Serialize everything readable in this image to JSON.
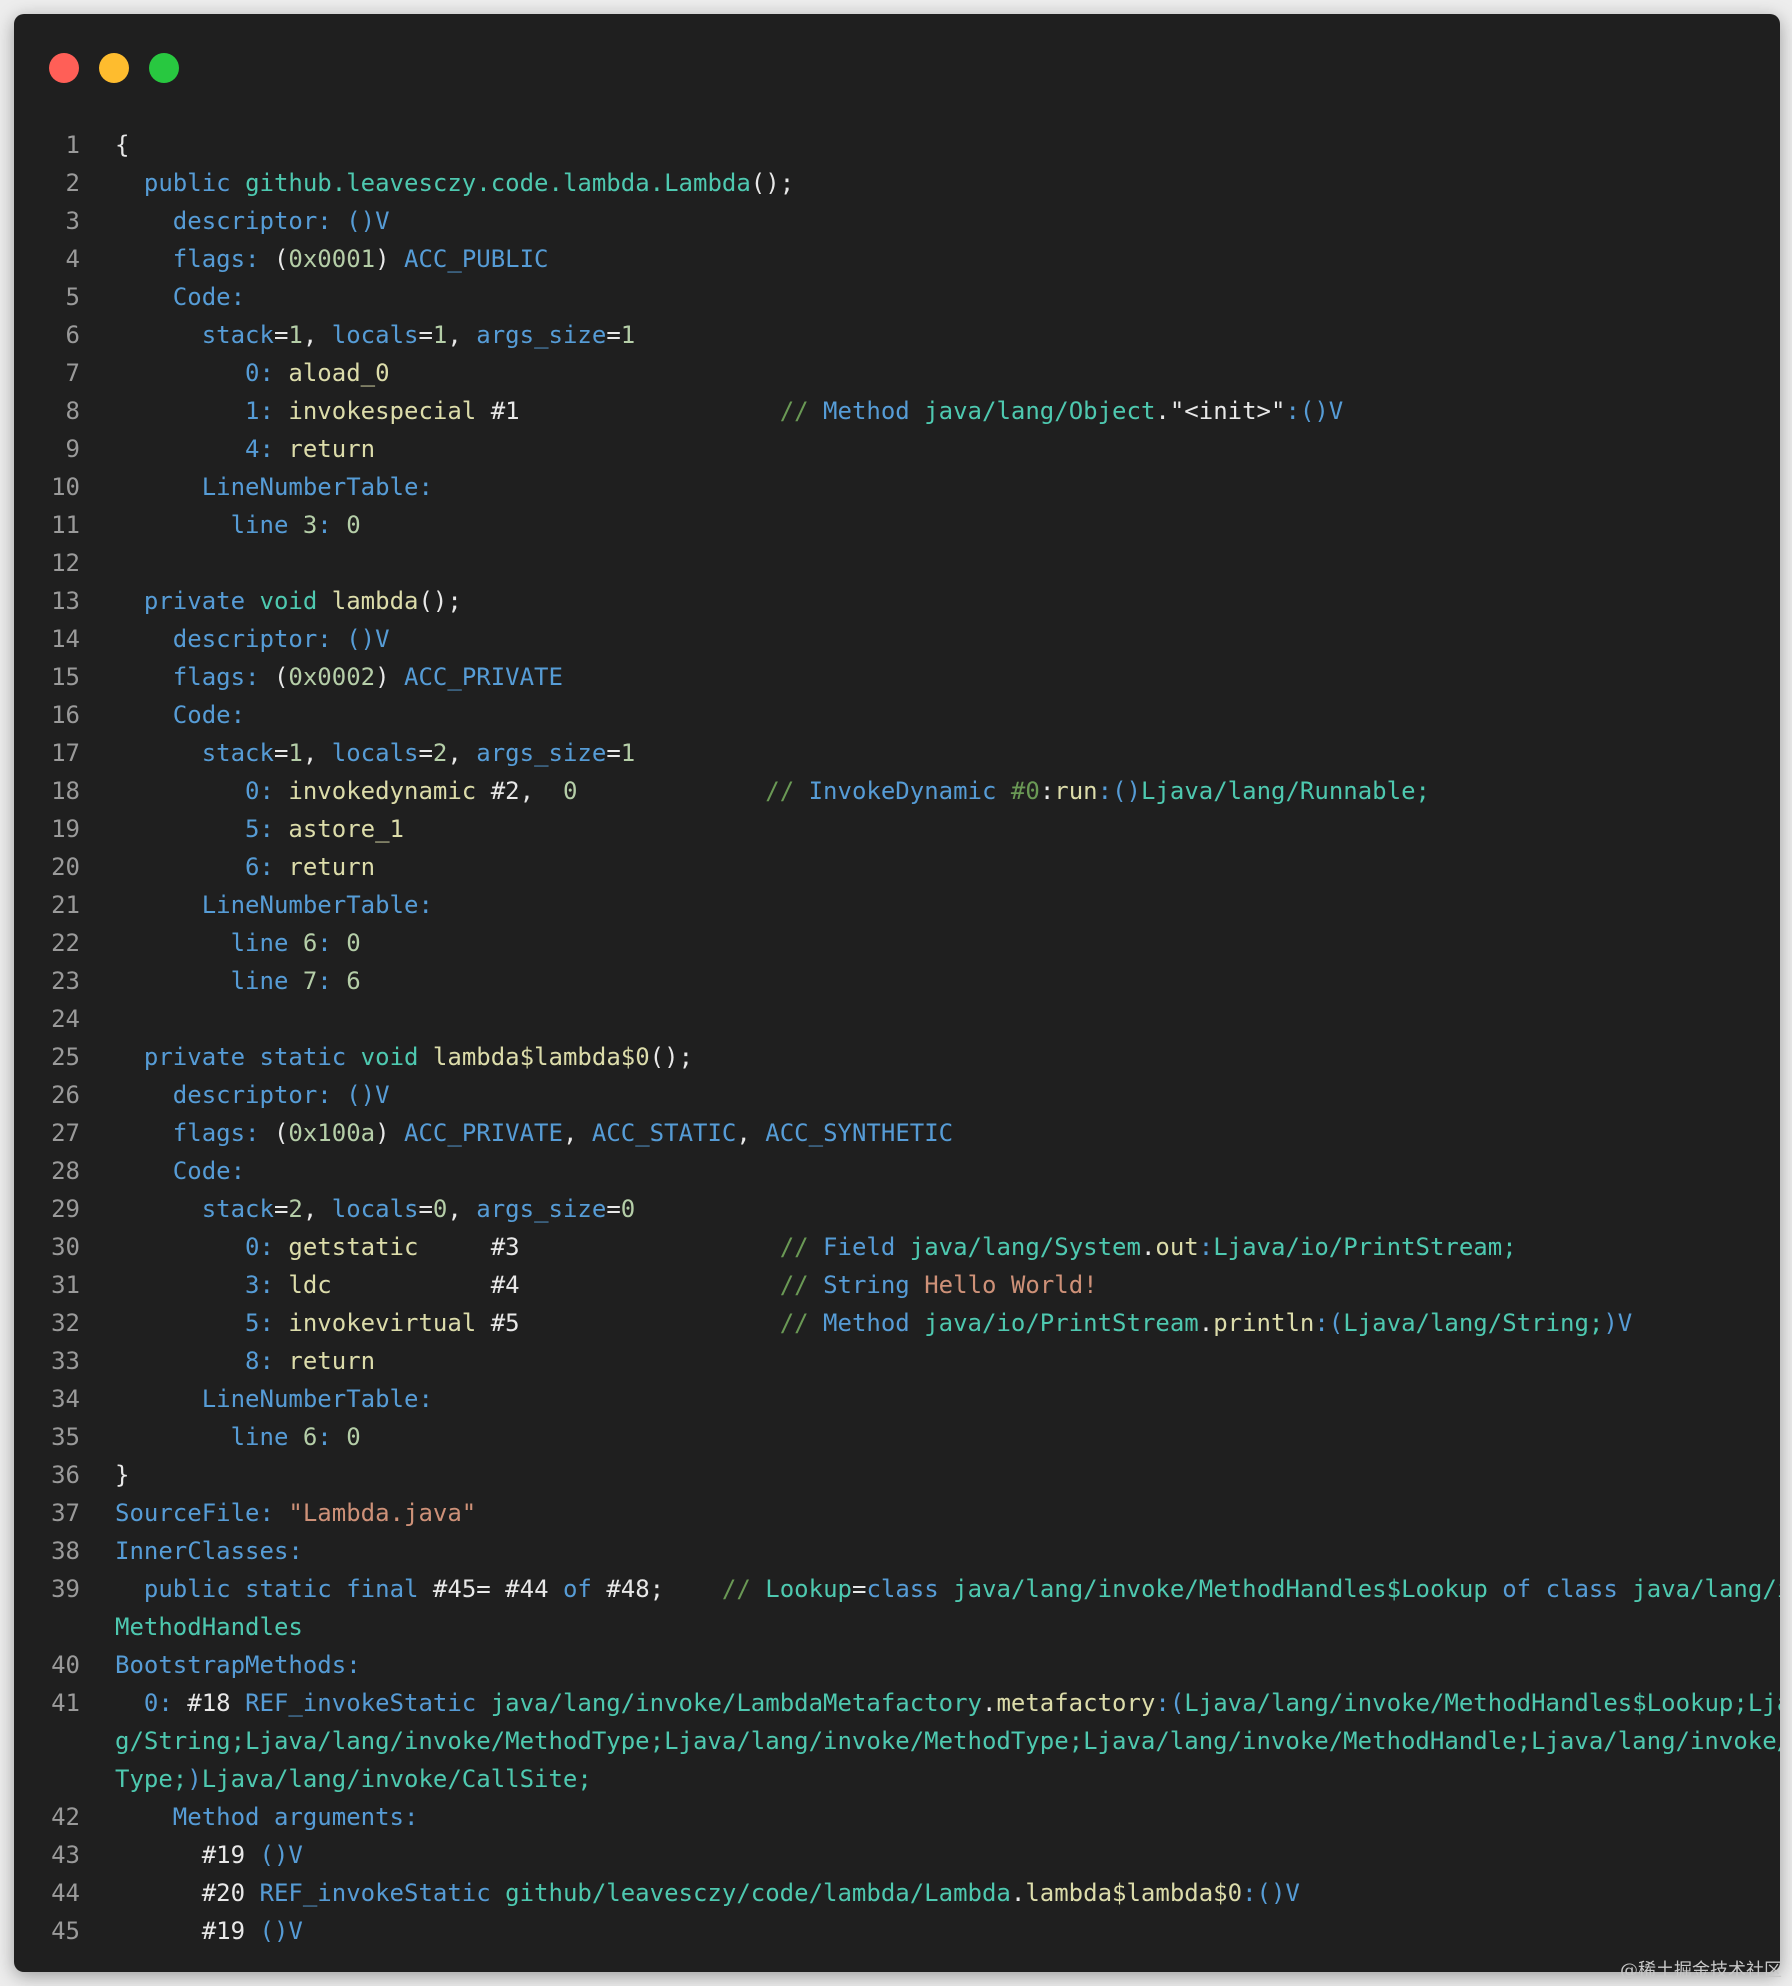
{
  "window": {
    "controls": [
      "close",
      "minimize",
      "maximize"
    ]
  },
  "lines": [
    {
      "n": "1",
      "tokens": [
        [
          "pl",
          "{"
        ]
      ]
    },
    {
      "n": "2",
      "tokens": [
        [
          "pl",
          "  "
        ],
        [
          "kw",
          "public"
        ],
        [
          "pl",
          " "
        ],
        [
          "ty",
          "github.leavesczy.code.lambda.Lambda"
        ],
        [
          "pl",
          "();"
        ]
      ]
    },
    {
      "n": "3",
      "tokens": [
        [
          "pl",
          "    "
        ],
        [
          "kw",
          "descriptor:"
        ],
        [
          "pl",
          " "
        ],
        [
          "kw",
          "()V"
        ]
      ]
    },
    {
      "n": "4",
      "tokens": [
        [
          "pl",
          "    "
        ],
        [
          "kw",
          "flags:"
        ],
        [
          "pl",
          " ("
        ],
        [
          "nm",
          "0x0001"
        ],
        [
          "pl",
          ") "
        ],
        [
          "kw",
          "ACC_PUBLIC"
        ]
      ]
    },
    {
      "n": "5",
      "tokens": [
        [
          "pl",
          "    "
        ],
        [
          "kw",
          "Code:"
        ]
      ]
    },
    {
      "n": "6",
      "tokens": [
        [
          "pl",
          "      "
        ],
        [
          "kw",
          "stack"
        ],
        [
          "pl",
          "="
        ],
        [
          "nm",
          "1"
        ],
        [
          "pl",
          ", "
        ],
        [
          "kw",
          "locals"
        ],
        [
          "pl",
          "="
        ],
        [
          "nm",
          "1"
        ],
        [
          "pl",
          ", "
        ],
        [
          "kw",
          "args_size"
        ],
        [
          "pl",
          "="
        ],
        [
          "nm",
          "1"
        ]
      ]
    },
    {
      "n": "7",
      "tokens": [
        [
          "pl",
          "         "
        ],
        [
          "kw",
          "0:"
        ],
        [
          "pl",
          " "
        ],
        [
          "fn",
          "aload_0"
        ]
      ]
    },
    {
      "n": "8",
      "tokens": [
        [
          "pl",
          "         "
        ],
        [
          "kw",
          "1:"
        ],
        [
          "pl",
          " "
        ],
        [
          "fn",
          "invokespecial"
        ],
        [
          "pl",
          " #1                  "
        ],
        [
          "cm",
          "//"
        ],
        [
          "pl",
          " "
        ],
        [
          "kw",
          "Method"
        ],
        [
          "pl",
          " "
        ],
        [
          "ty",
          "java/lang/Object"
        ],
        [
          "pl",
          "."
        ],
        [
          "pl",
          "\"<init>\""
        ],
        [
          "kw",
          ":()V"
        ]
      ]
    },
    {
      "n": "9",
      "tokens": [
        [
          "pl",
          "         "
        ],
        [
          "kw",
          "4:"
        ],
        [
          "pl",
          " "
        ],
        [
          "fn",
          "return"
        ]
      ]
    },
    {
      "n": "10",
      "tokens": [
        [
          "pl",
          "      "
        ],
        [
          "kw",
          "LineNumberTable:"
        ]
      ]
    },
    {
      "n": "11",
      "tokens": [
        [
          "pl",
          "        "
        ],
        [
          "kw",
          "line"
        ],
        [
          "pl",
          " "
        ],
        [
          "nm",
          "3"
        ],
        [
          "kw",
          ":"
        ],
        [
          "pl",
          " "
        ],
        [
          "nm",
          "0"
        ]
      ]
    },
    {
      "n": "12",
      "tokens": [
        [
          "pl",
          ""
        ]
      ]
    },
    {
      "n": "13",
      "tokens": [
        [
          "pl",
          "  "
        ],
        [
          "kw",
          "private"
        ],
        [
          "pl",
          " "
        ],
        [
          "ty",
          "void"
        ],
        [
          "pl",
          " "
        ],
        [
          "fn",
          "lambda"
        ],
        [
          "pl",
          "();"
        ]
      ]
    },
    {
      "n": "14",
      "tokens": [
        [
          "pl",
          "    "
        ],
        [
          "kw",
          "descriptor:"
        ],
        [
          "pl",
          " "
        ],
        [
          "kw",
          "()V"
        ]
      ]
    },
    {
      "n": "15",
      "tokens": [
        [
          "pl",
          "    "
        ],
        [
          "kw",
          "flags:"
        ],
        [
          "pl",
          " ("
        ],
        [
          "nm",
          "0x0002"
        ],
        [
          "pl",
          ") "
        ],
        [
          "kw",
          "ACC_PRIVATE"
        ]
      ]
    },
    {
      "n": "16",
      "tokens": [
        [
          "pl",
          "    "
        ],
        [
          "kw",
          "Code:"
        ]
      ]
    },
    {
      "n": "17",
      "tokens": [
        [
          "pl",
          "      "
        ],
        [
          "kw",
          "stack"
        ],
        [
          "pl",
          "="
        ],
        [
          "nm",
          "1"
        ],
        [
          "pl",
          ", "
        ],
        [
          "kw",
          "locals"
        ],
        [
          "pl",
          "="
        ],
        [
          "nm",
          "2"
        ],
        [
          "pl",
          ", "
        ],
        [
          "kw",
          "args_size"
        ],
        [
          "pl",
          "="
        ],
        [
          "nm",
          "1"
        ]
      ]
    },
    {
      "n": "18",
      "tokens": [
        [
          "pl",
          "         "
        ],
        [
          "kw",
          "0:"
        ],
        [
          "pl",
          " "
        ],
        [
          "fn",
          "invokedynamic"
        ],
        [
          "pl",
          " #2,  "
        ],
        [
          "nm",
          "0"
        ],
        [
          "pl",
          "             "
        ],
        [
          "cm",
          "//"
        ],
        [
          "pl",
          " "
        ],
        [
          "kw",
          "InvokeDynamic"
        ],
        [
          "pl",
          " "
        ],
        [
          "cm",
          "#0"
        ],
        [
          "pl",
          ":"
        ],
        [
          "fn",
          "run"
        ],
        [
          "kw",
          ":()"
        ],
        [
          "ty",
          "Ljava/lang/Runnable;"
        ]
      ]
    },
    {
      "n": "19",
      "tokens": [
        [
          "pl",
          "         "
        ],
        [
          "kw",
          "5:"
        ],
        [
          "pl",
          " "
        ],
        [
          "fn",
          "astore_1"
        ]
      ]
    },
    {
      "n": "20",
      "tokens": [
        [
          "pl",
          "         "
        ],
        [
          "kw",
          "6:"
        ],
        [
          "pl",
          " "
        ],
        [
          "fn",
          "return"
        ]
      ]
    },
    {
      "n": "21",
      "tokens": [
        [
          "pl",
          "      "
        ],
        [
          "kw",
          "LineNumberTable:"
        ]
      ]
    },
    {
      "n": "22",
      "tokens": [
        [
          "pl",
          "        "
        ],
        [
          "kw",
          "line"
        ],
        [
          "pl",
          " "
        ],
        [
          "nm",
          "6"
        ],
        [
          "kw",
          ":"
        ],
        [
          "pl",
          " "
        ],
        [
          "nm",
          "0"
        ]
      ]
    },
    {
      "n": "23",
      "tokens": [
        [
          "pl",
          "        "
        ],
        [
          "kw",
          "line"
        ],
        [
          "pl",
          " "
        ],
        [
          "nm",
          "7"
        ],
        [
          "kw",
          ":"
        ],
        [
          "pl",
          " "
        ],
        [
          "nm",
          "6"
        ]
      ]
    },
    {
      "n": "24",
      "tokens": [
        [
          "pl",
          ""
        ]
      ]
    },
    {
      "n": "25",
      "tokens": [
        [
          "pl",
          "  "
        ],
        [
          "kw",
          "private"
        ],
        [
          "pl",
          " "
        ],
        [
          "kw",
          "static"
        ],
        [
          "pl",
          " "
        ],
        [
          "ty",
          "void"
        ],
        [
          "pl",
          " "
        ],
        [
          "fn",
          "lambda$lambda$0"
        ],
        [
          "pl",
          "();"
        ]
      ]
    },
    {
      "n": "26",
      "tokens": [
        [
          "pl",
          "    "
        ],
        [
          "kw",
          "descriptor:"
        ],
        [
          "pl",
          " "
        ],
        [
          "kw",
          "()V"
        ]
      ]
    },
    {
      "n": "27",
      "tokens": [
        [
          "pl",
          "    "
        ],
        [
          "kw",
          "flags:"
        ],
        [
          "pl",
          " ("
        ],
        [
          "nm",
          "0x100a"
        ],
        [
          "pl",
          ") "
        ],
        [
          "kw",
          "ACC_PRIVATE"
        ],
        [
          "pl",
          ", "
        ],
        [
          "kw",
          "ACC_STATIC"
        ],
        [
          "pl",
          ", "
        ],
        [
          "kw",
          "ACC_SYNTHETIC"
        ]
      ]
    },
    {
      "n": "28",
      "tokens": [
        [
          "pl",
          "    "
        ],
        [
          "kw",
          "Code:"
        ]
      ]
    },
    {
      "n": "29",
      "tokens": [
        [
          "pl",
          "      "
        ],
        [
          "kw",
          "stack"
        ],
        [
          "pl",
          "="
        ],
        [
          "nm",
          "2"
        ],
        [
          "pl",
          ", "
        ],
        [
          "kw",
          "locals"
        ],
        [
          "pl",
          "="
        ],
        [
          "nm",
          "0"
        ],
        [
          "pl",
          ", "
        ],
        [
          "kw",
          "args_size"
        ],
        [
          "pl",
          "="
        ],
        [
          "nm",
          "0"
        ]
      ]
    },
    {
      "n": "30",
      "tokens": [
        [
          "pl",
          "         "
        ],
        [
          "kw",
          "0:"
        ],
        [
          "pl",
          " "
        ],
        [
          "fn",
          "getstatic"
        ],
        [
          "pl",
          "     #3                  "
        ],
        [
          "cm",
          "//"
        ],
        [
          "pl",
          " "
        ],
        [
          "kw",
          "Field"
        ],
        [
          "pl",
          " "
        ],
        [
          "ty",
          "java/lang/System"
        ],
        [
          "pl",
          "."
        ],
        [
          "fn",
          "out"
        ],
        [
          "kw",
          ":"
        ],
        [
          "ty",
          "Ljava/io/PrintStream;"
        ]
      ]
    },
    {
      "n": "31",
      "tokens": [
        [
          "pl",
          "         "
        ],
        [
          "kw",
          "3:"
        ],
        [
          "pl",
          " "
        ],
        [
          "fn",
          "ldc"
        ],
        [
          "pl",
          "           #4                  "
        ],
        [
          "cm",
          "//"
        ],
        [
          "pl",
          " "
        ],
        [
          "kw",
          "String"
        ],
        [
          "pl",
          " "
        ],
        [
          "str",
          "Hello World!"
        ]
      ]
    },
    {
      "n": "32",
      "tokens": [
        [
          "pl",
          "         "
        ],
        [
          "kw",
          "5:"
        ],
        [
          "pl",
          " "
        ],
        [
          "fn",
          "invokevirtual"
        ],
        [
          "pl",
          " #5                  "
        ],
        [
          "cm",
          "//"
        ],
        [
          "pl",
          " "
        ],
        [
          "kw",
          "Method"
        ],
        [
          "pl",
          " "
        ],
        [
          "ty",
          "java/io/PrintStream"
        ],
        [
          "pl",
          "."
        ],
        [
          "fn",
          "println"
        ],
        [
          "kw",
          ":("
        ],
        [
          "ty",
          "Ljava/lang/String;"
        ],
        [
          "kw",
          ")V"
        ]
      ]
    },
    {
      "n": "33",
      "tokens": [
        [
          "pl",
          "         "
        ],
        [
          "kw",
          "8:"
        ],
        [
          "pl",
          " "
        ],
        [
          "fn",
          "return"
        ]
      ]
    },
    {
      "n": "34",
      "tokens": [
        [
          "pl",
          "      "
        ],
        [
          "kw",
          "LineNumberTable:"
        ]
      ]
    },
    {
      "n": "35",
      "tokens": [
        [
          "pl",
          "        "
        ],
        [
          "kw",
          "line"
        ],
        [
          "pl",
          " "
        ],
        [
          "nm",
          "6"
        ],
        [
          "kw",
          ":"
        ],
        [
          "pl",
          " "
        ],
        [
          "nm",
          "0"
        ]
      ]
    },
    {
      "n": "36",
      "tokens": [
        [
          "pl",
          "}"
        ]
      ]
    },
    {
      "n": "37",
      "tokens": [
        [
          "kw",
          "SourceFile:"
        ],
        [
          "pl",
          " "
        ],
        [
          "str",
          "\"Lambda.java\""
        ]
      ]
    },
    {
      "n": "38",
      "tokens": [
        [
          "kw",
          "InnerClasses:"
        ]
      ]
    },
    {
      "n": "39",
      "wrap": true,
      "tokens": [
        [
          "pl",
          "  "
        ],
        [
          "kw",
          "public"
        ],
        [
          "pl",
          " "
        ],
        [
          "kw",
          "static"
        ],
        [
          "pl",
          " "
        ],
        [
          "kw",
          "final"
        ],
        [
          "pl",
          " #45= #44 "
        ],
        [
          "kw",
          "of"
        ],
        [
          "pl",
          " #48;    "
        ],
        [
          "cm",
          "//"
        ],
        [
          "pl",
          " "
        ],
        [
          "ty",
          "Lookup"
        ],
        [
          "pl",
          "="
        ],
        [
          "kw",
          "class"
        ],
        [
          "pl",
          " "
        ],
        [
          "ty",
          "java/lang/invoke/MethodHandles$Lookup"
        ],
        [
          "pl",
          " "
        ],
        [
          "kw",
          "of"
        ],
        [
          "pl",
          " "
        ],
        [
          "kw",
          "class"
        ],
        [
          "pl",
          " "
        ],
        [
          "ty",
          "java/lang/invoke/MethodHandles"
        ]
      ]
    },
    {
      "n": "40",
      "tokens": [
        [
          "kw",
          "BootstrapMethods:"
        ]
      ]
    },
    {
      "n": "41",
      "wrap": true,
      "tokens": [
        [
          "pl",
          "  "
        ],
        [
          "kw",
          "0:"
        ],
        [
          "pl",
          " #18 "
        ],
        [
          "kw",
          "REF_invokeStatic"
        ],
        [
          "pl",
          " "
        ],
        [
          "ty",
          "java/lang/invoke/LambdaMetafactory"
        ],
        [
          "pl",
          "."
        ],
        [
          "fn",
          "metafactory"
        ],
        [
          "kw",
          ":("
        ],
        [
          "ty",
          "Ljava/lang/invoke/MethodHandles$Lookup;Ljava/lang/String;Ljava/lang/invoke/MethodType;Ljava/lang/invoke/MethodType;Ljava/lang/invoke/MethodHandle;Ljava/lang/invoke/MethodType;"
        ],
        [
          "kw",
          ")"
        ],
        [
          "ty",
          "Ljava/lang/invoke/CallSite;"
        ]
      ]
    },
    {
      "n": "42",
      "tokens": [
        [
          "pl",
          "    "
        ],
        [
          "kw",
          "Method arguments:"
        ]
      ]
    },
    {
      "n": "43",
      "tokens": [
        [
          "pl",
          "      #19 "
        ],
        [
          "kw",
          "()V"
        ]
      ]
    },
    {
      "n": "44",
      "tokens": [
        [
          "pl",
          "      #20 "
        ],
        [
          "kw",
          "REF_invokeStatic"
        ],
        [
          "pl",
          " "
        ],
        [
          "ty",
          "github/leavesczy/code/lambda/Lambda"
        ],
        [
          "pl",
          "."
        ],
        [
          "fn",
          "lambda$lambda$0"
        ],
        [
          "kw",
          ":()V"
        ]
      ]
    },
    {
      "n": "45",
      "tokens": [
        [
          "pl",
          "      #19 "
        ],
        [
          "kw",
          "()V"
        ]
      ]
    }
  ],
  "watermark": "@稀土掘金技术社区"
}
